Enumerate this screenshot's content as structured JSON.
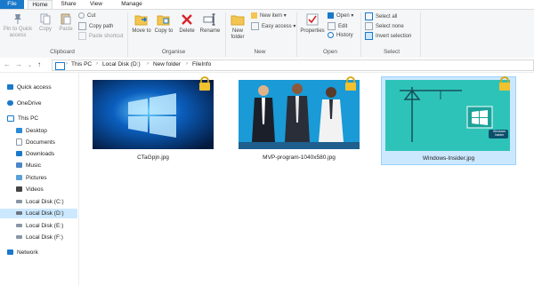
{
  "tabs": {
    "file": "File",
    "home": "Home",
    "share": "Share",
    "view": "View",
    "manage": "Manage"
  },
  "ribbon": {
    "clipboard": {
      "pin_to_quick_access": "Pin to Quick access",
      "copy": "Copy",
      "paste": "Paste",
      "cut": "Cut",
      "copy_path": "Copy path",
      "paste_shortcut": "Paste shortcut",
      "label": "Clipboard"
    },
    "organise": {
      "move_to": "Move to",
      "copy_to": "Copy to",
      "delete": "Delete",
      "rename": "Rename",
      "label": "Organise"
    },
    "new": {
      "new_folder": "New folder",
      "new_item": "New item",
      "easy_access": "Easy access",
      "label": "New"
    },
    "open": {
      "properties": "Properties",
      "open": "Open",
      "edit": "Edit",
      "history": "History",
      "label": "Open"
    },
    "select": {
      "select_all": "Select all",
      "select_none": "Select none",
      "invert_selection": "Invert selection",
      "label": "Select"
    }
  },
  "address": {
    "crumbs": [
      "This PC",
      "Local Disk (D:)",
      "New folder",
      "FileInfo"
    ]
  },
  "sidebar": {
    "items": [
      {
        "label": "Quick access"
      },
      {
        "label": "OneDrive"
      },
      {
        "label": "This PC"
      },
      {
        "label": "Desktop"
      },
      {
        "label": "Documents"
      },
      {
        "label": "Downloads"
      },
      {
        "label": "Music"
      },
      {
        "label": "Pictures"
      },
      {
        "label": "Videos"
      },
      {
        "label": "Local Disk (C:)"
      },
      {
        "label": "Local Disk (D:)"
      },
      {
        "label": "Local Disk (E:)"
      },
      {
        "label": "Local Disk (F:)"
      },
      {
        "label": "Network"
      }
    ]
  },
  "files": [
    {
      "name": "CTaGpjn.jpg"
    },
    {
      "name": "MVP-program-1040x580.jpg"
    },
    {
      "name": "Windows-Insider.jpg"
    }
  ],
  "thumb_texts": {
    "insider_badge": "Windows Insider"
  },
  "colors": {
    "accent": "#1979ca",
    "selection": "#cce8ff",
    "lock": "#f2c12e"
  }
}
